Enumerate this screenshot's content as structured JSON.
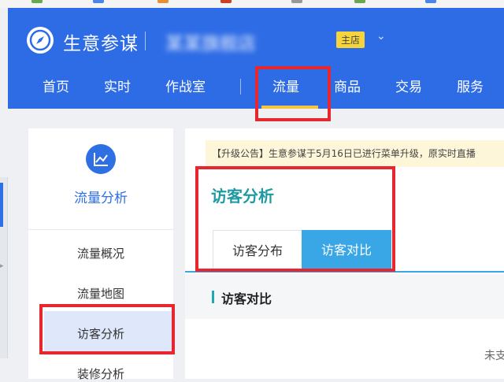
{
  "header": {
    "brand": "生意参谋",
    "shop_name": "某某旗舰店",
    "shop_badge": "主店",
    "dropdown_icon": "chevron-down-icon"
  },
  "nav": {
    "items": [
      {
        "label": "首页"
      },
      {
        "label": "实时"
      },
      {
        "label": "作战室"
      },
      {
        "label": "流量"
      },
      {
        "label": "商品"
      },
      {
        "label": "交易"
      },
      {
        "label": "服务"
      }
    ],
    "active": "流量"
  },
  "sidebar": {
    "title": "流量分析",
    "icon": "trend-chart-icon",
    "items": [
      {
        "label": "流量概况"
      },
      {
        "label": "流量地图"
      },
      {
        "label": "访客分析"
      },
      {
        "label": "装修分析"
      }
    ],
    "active": "访客分析"
  },
  "main": {
    "notice": "【升级公告】生意参谋于5月16日已进行菜单升级，原实时直播",
    "page_title": "访客分析",
    "tabs": [
      {
        "label": "访客分布"
      },
      {
        "label": "访客对比"
      }
    ],
    "active_tab": "访客对比",
    "section_title": "访客对比",
    "cut_text": "未支"
  },
  "colors": {
    "header_blue": "#2e6ce6",
    "highlight_red": "#e8262e",
    "badge_yellow": "#f7d33c",
    "tab_active": "#39a7e6",
    "title_teal": "#1f9aa3"
  }
}
